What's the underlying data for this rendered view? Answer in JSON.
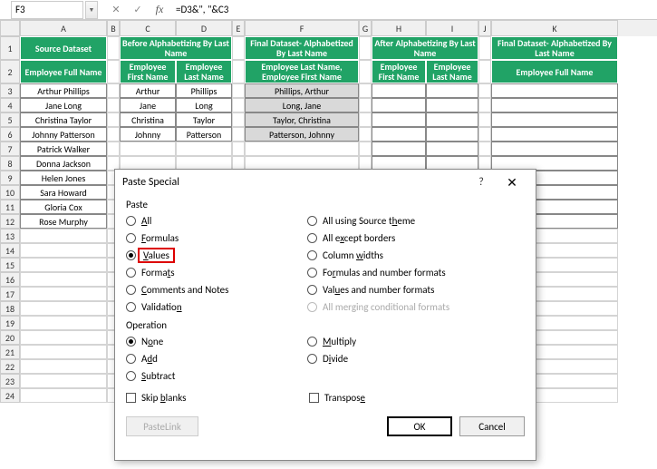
{
  "nameBox": "F3",
  "formula": "=D3&\", \"&C3",
  "colHeaders": [
    "A",
    "B",
    "C",
    "D",
    "E",
    "F",
    "G",
    "H",
    "I",
    "J",
    "K"
  ],
  "rowNumbers": [
    "1",
    "2",
    "3",
    "4",
    "5",
    "6",
    "7",
    "8",
    "9",
    "10",
    "11",
    "12",
    "13",
    "14",
    "15",
    "16",
    "17",
    "18",
    "19",
    "20",
    "21",
    "22",
    "23",
    "24"
  ],
  "headers": {
    "A1": "Source Dataset",
    "CD1": "Before Alphabetizing By Last Name",
    "F1": "Final Dataset- Alphabetized By Last Name",
    "HI1": "After Alphabetizing By Last Name",
    "K1": "Final Dataset- Alphabetized By Last Name",
    "A2": "Employee Full Name",
    "C2": "Employee First Name",
    "D2": "Employee Last Name",
    "F2": "Employee Last Name, Employee First Name",
    "H2": "Employee First Name",
    "I2": "Employee Last Name",
    "K2": "Employee Full Name"
  },
  "dataA": [
    "Arthur Phillips",
    "Jane Long",
    "Christina Taylor",
    "Johnny Patterson",
    "Patrick Walker",
    "Donna Jackson",
    "Helen Jones",
    "Sara Howard",
    "Gloria Cox",
    "Rose Murphy"
  ],
  "dataC": [
    "Arthur",
    "Jane",
    "Christina",
    "Johnny"
  ],
  "dataD": [
    "Phillips",
    "Long",
    "Taylor",
    "Patterson"
  ],
  "dataF": [
    "Phillips, Arthur",
    "Long, Jane",
    "Taylor, Christina",
    "Patterson, Johnny"
  ],
  "dialog": {
    "title": "Paste Special",
    "groupPaste": "Paste",
    "groupOp": "Operation",
    "all": "All",
    "formulas": "Formulas",
    "values": "Values",
    "formats": "Formats",
    "comments": "Comments and Notes",
    "validation": "Validation",
    "allTheme": "All using Source theme",
    "allBorders": "All except borders",
    "colWidths": "Column widths",
    "formNum": "Formulas and number formats",
    "valNum": "Values and number formats",
    "allMerge": "All merging conditional formats",
    "none": "None",
    "add": "Add",
    "subtract": "Subtract",
    "multiply": "Multiply",
    "divide": "Divide",
    "skipBlanks": "Skip blanks",
    "transpose": "Transpose",
    "pasteLink": "Paste Link",
    "ok": "OK",
    "cancel": "Cancel"
  }
}
